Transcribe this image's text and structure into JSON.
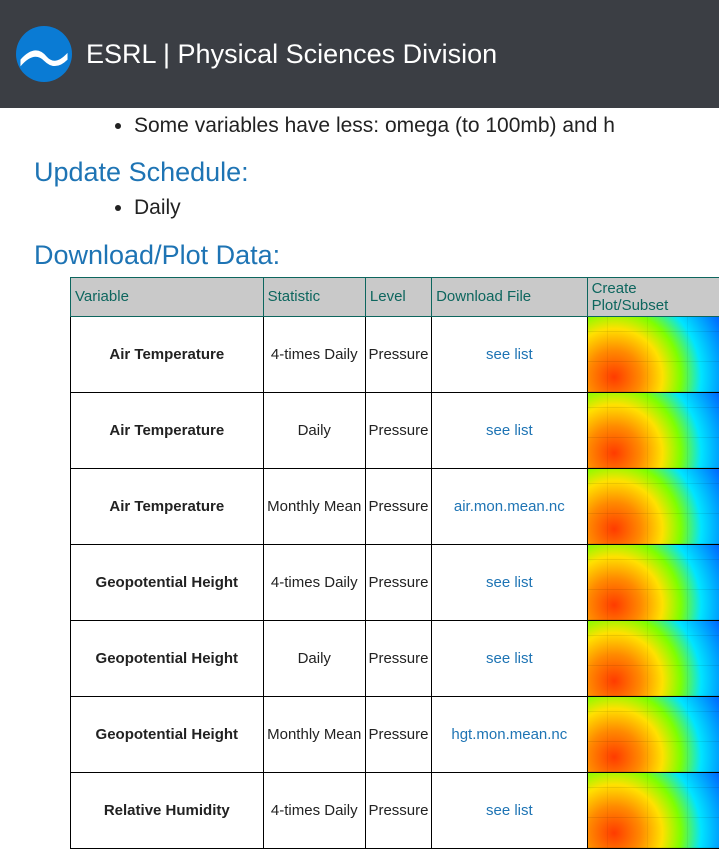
{
  "header": {
    "title": "ESRL | Physical Sciences Division"
  },
  "partial_bullet": "Some variables have less: omega (to 100mb) and h",
  "sections": {
    "update_schedule": {
      "title": "Update Schedule:",
      "items": [
        "Daily"
      ]
    },
    "download_plot": {
      "title": "Download/Plot Data:",
      "columns": [
        "Variable",
        "Statistic",
        "Level",
        "Download File",
        "Create Plot/Subset"
      ],
      "rows": [
        {
          "variable": "Air Temperature",
          "statistic": "4-times Daily",
          "level": "Pressure",
          "download": "see list"
        },
        {
          "variable": "Air Temperature",
          "statistic": "Daily",
          "level": "Pressure",
          "download": "see list"
        },
        {
          "variable": "Air Temperature",
          "statistic": "Monthly Mean",
          "level": "Pressure",
          "download": "air.mon.mean.nc"
        },
        {
          "variable": "Geopotential Height",
          "statistic": "4-times Daily",
          "level": "Pressure",
          "download": "see list"
        },
        {
          "variable": "Geopotential Height",
          "statistic": "Daily",
          "level": "Pressure",
          "download": "see list"
        },
        {
          "variable": "Geopotential Height",
          "statistic": "Monthly Mean",
          "level": "Pressure",
          "download": "hgt.mon.mean.nc"
        },
        {
          "variable": "Relative Humidity",
          "statistic": "4-times Daily",
          "level": "Pressure",
          "download": "see list"
        }
      ]
    }
  }
}
